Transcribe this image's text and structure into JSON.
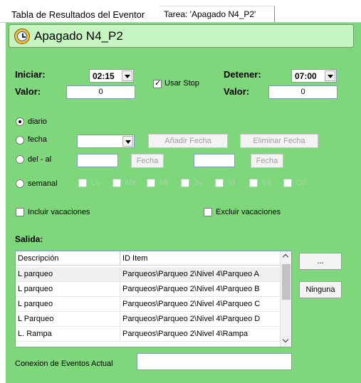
{
  "tabs": [
    {
      "label": "Tabla de Resultados del Eventor"
    },
    {
      "label": "Tarea: 'Apagado N4_P2'"
    }
  ],
  "title": "Apagado N4_P2",
  "schedule": {
    "start_label": "Iniciar:",
    "start_time": "02:15",
    "start_value_label": "Valor:",
    "start_value": "0",
    "use_stop_label": "Usar Stop",
    "use_stop_checked": true,
    "stop_label": "Detener:",
    "stop_time": "07:00",
    "stop_value_label": "Valor:",
    "stop_value": "0"
  },
  "frequency": {
    "daily_label": "diario",
    "date_label": "fecha",
    "range_label": "del - al",
    "weekly_label": "semanal",
    "selected": "diario",
    "add_date_button": "Añadir Fecha",
    "remove_date_button": "Eliminar Fecha",
    "date_button_1": "Fecha",
    "date_button_2": "Fecha",
    "days": [
      "Lu",
      "Ma",
      "Mi",
      "Ju",
      "Vi",
      "Sa",
      "Do"
    ]
  },
  "vacations": {
    "include_label": "Incluir vacaciones",
    "exclude_label": "Excluir vacaciones"
  },
  "output": {
    "label": "Salida:",
    "columns": [
      "Descripción",
      "ID Item"
    ],
    "rows": [
      {
        "desc": "L parqueo",
        "id": "Parqueos\\Parqueo 2\\Nivel 4\\Parqueo A"
      },
      {
        "desc": "L parqueo",
        "id": "Parqueos\\Parqueo 2\\Nivel 4\\Parqueo B"
      },
      {
        "desc": "L parqueo",
        "id": "Parqueos\\Parqueo 2\\Nivel 4\\Parqueo C"
      },
      {
        "desc": "L Parqueo",
        "id": "Parqueos\\Parqueo 2\\Nivel 4\\Parqueo D"
      },
      {
        "desc": "L. Rampa",
        "id": "Parqueos\\Parqueo 2\\Nivel 4\\Rampa"
      }
    ],
    "ellipsis_button": "...",
    "none_button": "Ninguna"
  },
  "connection": {
    "label": "Conexion de Eventos Actual",
    "value": ""
  }
}
